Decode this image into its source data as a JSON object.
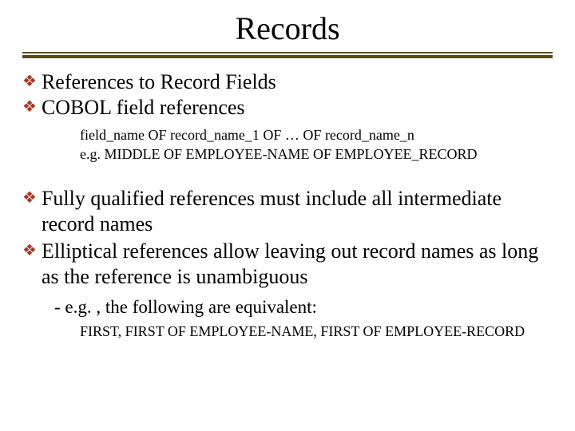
{
  "title": "Records",
  "bullets": {
    "b1": "References to Record Fields",
    "b2": "COBOL field references",
    "b2_sub_line1": "field_name OF record_name_1 OF … OF record_name_n",
    "b2_sub_line2": "e.g. MIDDLE OF EMPLOYEE-NAME OF EMPLOYEE_RECORD",
    "b3": "Fully qualified references must include all intermediate record names",
    "b4": "Elliptical references allow leaving out record names as long as the reference is unambiguous",
    "b4_sub": "- e.g. , the following are equivalent:",
    "b4_sub2": "FIRST,   FIRST OF EMPLOYEE-NAME, FIRST OF EMPLOYEE-RECORD"
  },
  "colors": {
    "accent": "#a63a24",
    "rule": "#5a4a0f"
  }
}
